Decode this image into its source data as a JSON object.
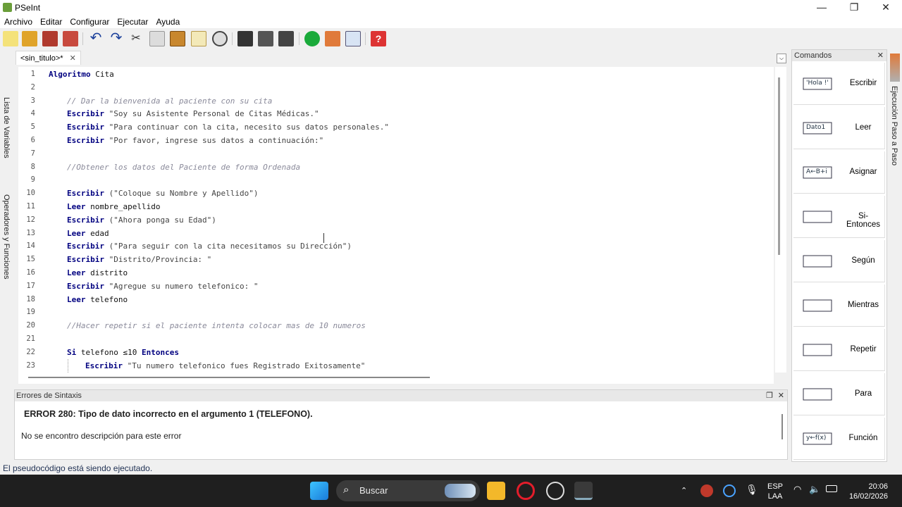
{
  "window": {
    "title": "PSeInt",
    "minimize": "—",
    "maximize": "❐",
    "close": "✕"
  },
  "menu": [
    "Archivo",
    "Editar",
    "Configurar",
    "Ejecutar",
    "Ayuda"
  ],
  "toolbar_icons": [
    "new-file-icon",
    "open-folder-icon",
    "save-icon",
    "save-as-icon",
    "undo-icon",
    "redo-icon",
    "cut-icon",
    "copy-icon",
    "paste-icon",
    "edit-icon",
    "find-icon",
    "indent-icon",
    "lines-icon",
    "wrench-icon",
    "run-icon",
    "step-icon",
    "diagram-icon",
    "help-icon"
  ],
  "left_strip": {
    "variables": "Lista de Variables",
    "operators": "Operadores y Funciones"
  },
  "tab": {
    "label": "<sin_titulo>*",
    "close": "✕"
  },
  "editor": {
    "lines": [
      {
        "n": "1",
        "indent": 0,
        "parts": [
          [
            "kw",
            "Algoritmo"
          ],
          [
            "id",
            " Cita"
          ]
        ]
      },
      {
        "n": "2",
        "indent": 0,
        "parts": []
      },
      {
        "n": "3",
        "indent": 1,
        "parts": [
          [
            "cm",
            "// Dar la bienvenida al paciente con su cita"
          ]
        ]
      },
      {
        "n": "4",
        "indent": 1,
        "parts": [
          [
            "kw",
            "Escribir"
          ],
          [
            "str",
            " \"Soy su Asistente Personal de Citas Médicas.\""
          ]
        ]
      },
      {
        "n": "5",
        "indent": 1,
        "parts": [
          [
            "kw",
            "Escribir"
          ],
          [
            "str",
            " \"Para continuar con la cita, necesito sus datos personales.\""
          ]
        ]
      },
      {
        "n": "6",
        "indent": 1,
        "parts": [
          [
            "kw",
            "Escribir"
          ],
          [
            "str",
            " \"Por favor, ingrese sus datos a continuación:\""
          ]
        ]
      },
      {
        "n": "7",
        "indent": 0,
        "parts": []
      },
      {
        "n": "8",
        "indent": 1,
        "parts": [
          [
            "cm",
            "//Obtener los datos del Paciente de forma Ordenada"
          ]
        ]
      },
      {
        "n": "9",
        "indent": 0,
        "parts": []
      },
      {
        "n": "10",
        "indent": 1,
        "parts": [
          [
            "kw",
            "Escribir"
          ],
          [
            "str",
            " (\"Coloque su Nombre y Apellido\")"
          ]
        ]
      },
      {
        "n": "11",
        "indent": 1,
        "parts": [
          [
            "kw",
            "Leer"
          ],
          [
            "id",
            " nombre_apellido"
          ]
        ]
      },
      {
        "n": "12",
        "indent": 1,
        "parts": [
          [
            "kw",
            "Escribir"
          ],
          [
            "str",
            " (\"Ahora ponga su Edad\")"
          ]
        ]
      },
      {
        "n": "13",
        "indent": 1,
        "parts": [
          [
            "kw",
            "Leer"
          ],
          [
            "id",
            " edad"
          ]
        ]
      },
      {
        "n": "14",
        "indent": 1,
        "parts": [
          [
            "kw",
            "Escribir"
          ],
          [
            "str",
            " (\"Para seguir con la cita necesitamos su Dirección\")"
          ]
        ]
      },
      {
        "n": "15",
        "indent": 1,
        "parts": [
          [
            "kw",
            "Escribir"
          ],
          [
            "str",
            " \"Distrito/Provincia: \""
          ]
        ]
      },
      {
        "n": "16",
        "indent": 1,
        "parts": [
          [
            "kw",
            "Leer"
          ],
          [
            "id",
            " distrito"
          ]
        ]
      },
      {
        "n": "17",
        "indent": 1,
        "parts": [
          [
            "kw",
            "Escribir"
          ],
          [
            "str",
            " \"Agregue su numero telefonico: \""
          ]
        ]
      },
      {
        "n": "18",
        "indent": 1,
        "parts": [
          [
            "kw",
            "Leer"
          ],
          [
            "id",
            " telefono"
          ]
        ]
      },
      {
        "n": "19",
        "indent": 0,
        "parts": []
      },
      {
        "n": "20",
        "indent": 1,
        "parts": [
          [
            "cm",
            "//Hacer repetir si el paciente intenta colocar mas de 10 numeros"
          ]
        ]
      },
      {
        "n": "21",
        "indent": 0,
        "parts": []
      },
      {
        "n": "22",
        "indent": 1,
        "parts": [
          [
            "kw",
            "Si"
          ],
          [
            "id",
            " telefono ≤10 "
          ],
          [
            "kw",
            "Entonces"
          ]
        ]
      },
      {
        "n": "23",
        "indent": 2,
        "parts": [
          [
            "kw",
            "Escribir"
          ],
          [
            "str",
            " \"Tu numero telefonico fues Registrado Exitosamente\""
          ]
        ]
      }
    ]
  },
  "commands": {
    "title": "Comandos",
    "close": "✕",
    "items": [
      {
        "label": "Escribir",
        "icon": "escribir-icon",
        "icon_text": "'Hola !'"
      },
      {
        "label": "Leer",
        "icon": "leer-icon",
        "icon_text": "Dato1"
      },
      {
        "label": "Asignar",
        "icon": "asignar-icon",
        "icon_text": "A←B+i"
      },
      {
        "label": "Si-Entonces",
        "icon": "si-entonces-icon",
        "icon_text": ""
      },
      {
        "label": "Según",
        "icon": "segun-icon",
        "icon_text": ""
      },
      {
        "label": "Mientras",
        "icon": "mientras-icon",
        "icon_text": ""
      },
      {
        "label": "Repetir",
        "icon": "repetir-icon",
        "icon_text": ""
      },
      {
        "label": "Para",
        "icon": "para-icon",
        "icon_text": ""
      },
      {
        "label": "Función",
        "icon": "funcion-icon",
        "icon_text": "y←f(x)"
      }
    ]
  },
  "right_strip": {
    "label": "Ejecución Paso a Paso"
  },
  "errors": {
    "title": "Errores de Sintaxis",
    "restore": "❐",
    "close": "✕",
    "message": "ERROR 280: Tipo de dato incorrecto en el argumento 1 (TELEFONO).",
    "description": "No se encontro descripción para este error"
  },
  "status": "El pseudocódigo está siendo ejecutado.",
  "taskbar": {
    "search_placeholder": "Buscar",
    "lang": "ESP",
    "layout": "LAA",
    "time": "20:06",
    "date": "16/02/2026"
  },
  "colors": {
    "keyword": "#000080",
    "comment": "#8a8a9a",
    "run": "#1aaa3a",
    "taskbar": "#1f1f1f"
  }
}
